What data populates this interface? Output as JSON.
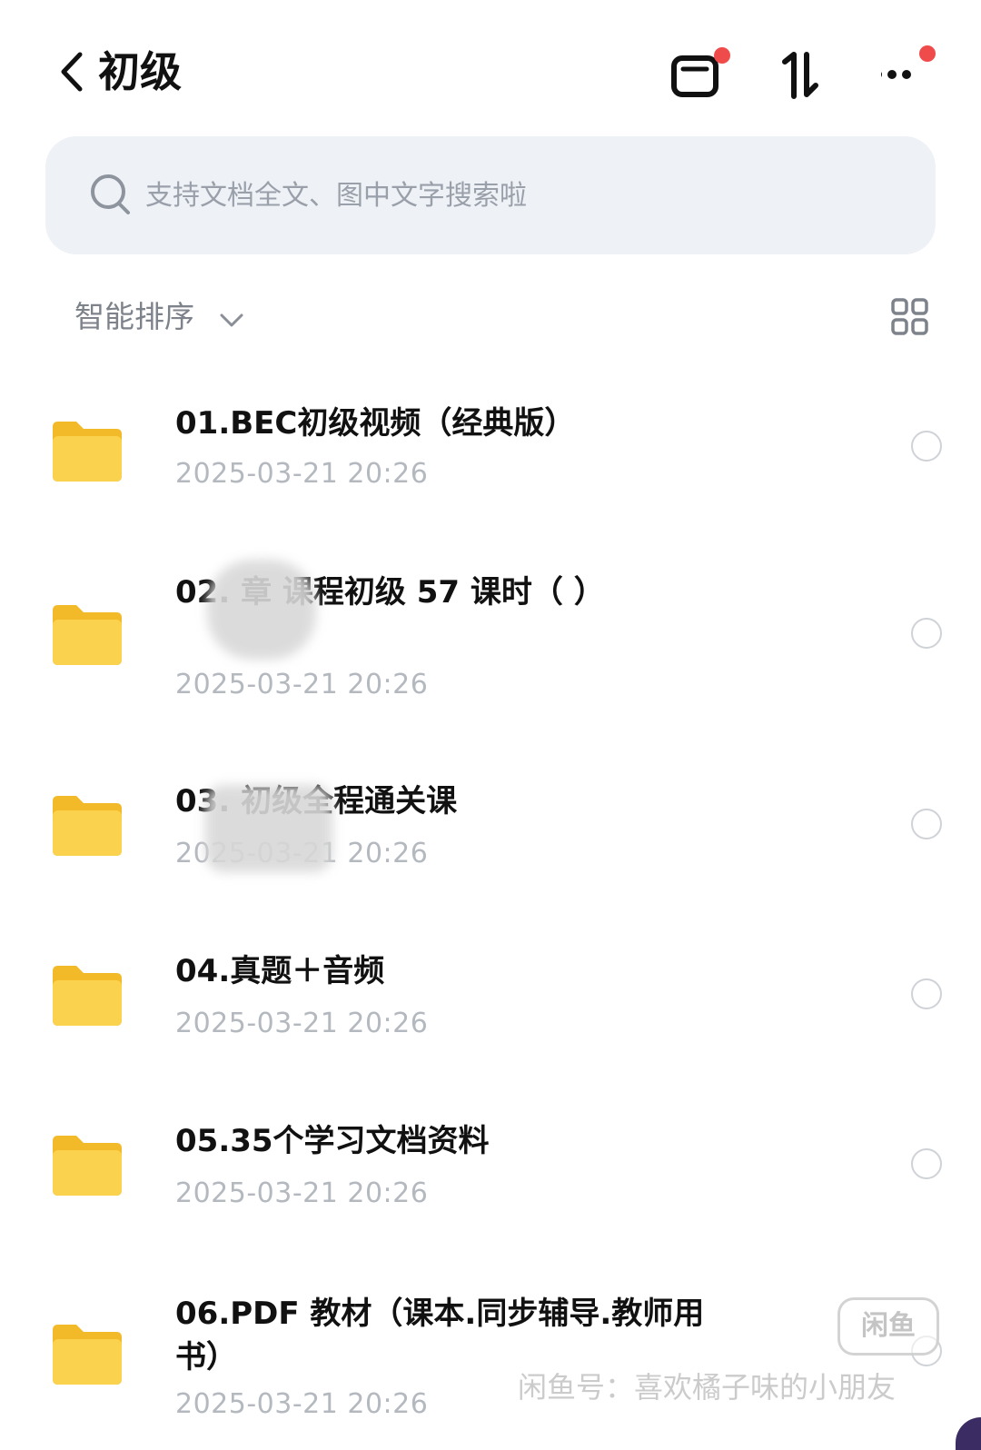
{
  "header": {
    "title": "初级",
    "back_icon": "chevron-left-icon",
    "actions": [
      {
        "icon": "transfer-icon",
        "badge": "red-dot"
      },
      {
        "icon": "sort-arrows-icon",
        "badge": null
      },
      {
        "icon": "more-icon",
        "badge": "red-dot"
      }
    ]
  },
  "search": {
    "placeholder": "支持文档全文、图中文字搜索啦",
    "icon": "search-icon"
  },
  "sortbar": {
    "label": "智能排序",
    "dropdown_icon": "chevron-down-icon",
    "view_icon": "grid-view-icon"
  },
  "files": [
    {
      "name": "01.BEC初级视频（经典版）",
      "date": "2025-03-21 20:26"
    },
    {
      "name": "02.    章          课程初级 57 课时（        ）",
      "date": "2025-03-21 20:26"
    },
    {
      "name": "03.       初级全程通关课",
      "date": "2025-03-21 20:26"
    },
    {
      "name": "04.真题＋音频",
      "date": "2025-03-21 20:26"
    },
    {
      "name": "05.35个学习文档资料",
      "date": "2025-03-21 20:26"
    },
    {
      "name": "06.PDF 教材（课本.同步辅导.教师用书）",
      "date": "2025-03-21 20:26"
    }
  ],
  "watermark": {
    "badge": "闲鱼",
    "text": "闲鱼号：喜欢橘子味的小朋友"
  },
  "colors": {
    "folder": "#f7c93c",
    "badge_red": "#f04b4b",
    "search_bg": "#eef1f6",
    "date_gray": "#b4b8bf"
  }
}
